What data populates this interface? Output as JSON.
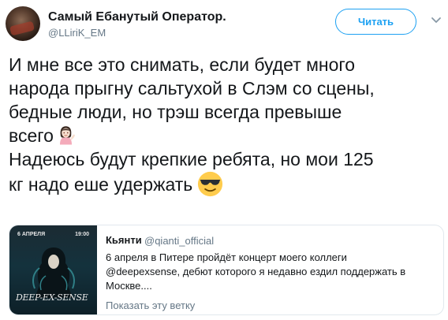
{
  "author": {
    "name": "Самый Ебанутый Оператор.",
    "handle": "@LLiriK_EM"
  },
  "follow_button": {
    "label": "Читать"
  },
  "icons": {
    "more": "chevron-down-icon",
    "emoji_1": "woman-tipping-hand-emoji",
    "emoji_2": "smiling-face-with-sunglasses-emoji"
  },
  "tweet": {
    "lines": [
      "И мне все это снимать, если будет много",
      "народа прыгну сальтухой в Слэм со сцены,",
      "бедные люди, но трэш  всегда превыше",
      "всего",
      "Надеюсь будут крепкие ребята, но мои 125",
      "кг надо еше удержать"
    ]
  },
  "quoted_tweet": {
    "name": "Кьянти",
    "handle": "@qianti_official",
    "lines": [
      "6 апреля в Питере пройдёт концерт моего коллеги",
      "@deepexsense, дебют которого я недавно ездил поддержать в",
      "Москве...."
    ],
    "show_thread": "Показать эту ветку",
    "media": {
      "date_label": "6 АПРЕЛЯ",
      "time_label": "19:00",
      "logo_text": "DEEP-EX-SENSE"
    }
  },
  "colors": {
    "accent": "#1da1f2",
    "text": "#14171a",
    "muted": "#657786",
    "border": "#e1e8ed"
  }
}
